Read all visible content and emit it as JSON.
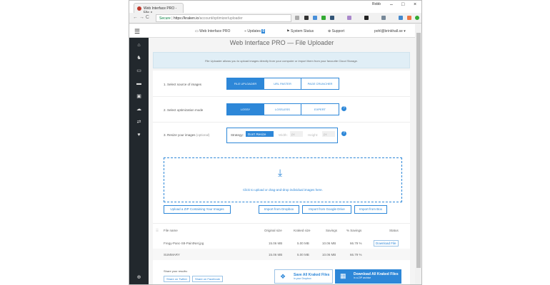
{
  "browser": {
    "tab_title": "Web Interface PRO - File",
    "profile": "Robb",
    "url_secure": "Secure",
    "url_host": "https://kraken.io",
    "url_path": "/account/optimizer/uploader"
  },
  "topnav": {
    "items": [
      "Web Interface PRO",
      "Updates",
      "System Status",
      "Support"
    ],
    "updates_badge": "0",
    "user": "pohl@brinkhall.se ▾"
  },
  "page": {
    "title": "Web Interface PRO — File Uploader",
    "info": "File Uploader allows you to upload images directly from your computer or import them from your favourite Cloud Storage."
  },
  "steps": {
    "source": {
      "label": "1. Select source of images",
      "options": [
        "FILE UPLOADER",
        "URL PASTER",
        "PAGE CRUNCHER"
      ],
      "selected": "FILE UPLOADER"
    },
    "mode": {
      "label": "2. Select optimization mode",
      "options": [
        "LOSSY",
        "LOSSLESS",
        "EXPERT"
      ],
      "selected": "LOSSY"
    },
    "resize": {
      "label": "3. Resize your images",
      "optional": "(optional)",
      "strategy_label": "Strategy:",
      "strategy_value": "Don't Resize",
      "width_label": "Width:",
      "height_label": "Height:",
      "unit": "px"
    }
  },
  "dropzone": {
    "text": "Click to upload or drag-and-drop individual images here."
  },
  "import": {
    "zip": "Upload a ZIP Containing Your Images",
    "dropbox": "Import from Dropbox",
    "gdrive": "Import from Google Drive",
    "box": "Import from Box"
  },
  "table": {
    "headers": [
      "File name",
      "Original size",
      "Kraked size",
      "Savings",
      "% Savings",
      "Status"
    ],
    "rows": [
      {
        "name": "Fregy-Panc-S8-PaintNet.jpg",
        "orig": "15.06 MB",
        "kraked": "5.00 MB",
        "savings": "10.06 MB",
        "pct": "66.79 %",
        "status": "Download File"
      }
    ],
    "summary": {
      "name": "SUMMARY",
      "orig": "15.06 MB",
      "kraked": "5.00 MB",
      "savings": "10.06 MB",
      "pct": "66.79 %"
    }
  },
  "share": {
    "label": "Share your results:",
    "twitter": "Share on Twitter",
    "facebook": "Share on Facebook"
  },
  "save_dropbox": {
    "title": "Save All Kraked Files",
    "sub": "in your Dropbox"
  },
  "download_zip": {
    "title": "Download All Kraked Files",
    "sub": "in a ZIP archive"
  },
  "colors": {
    "accent": "#2d87d8",
    "sidebar": "#22282d"
  }
}
